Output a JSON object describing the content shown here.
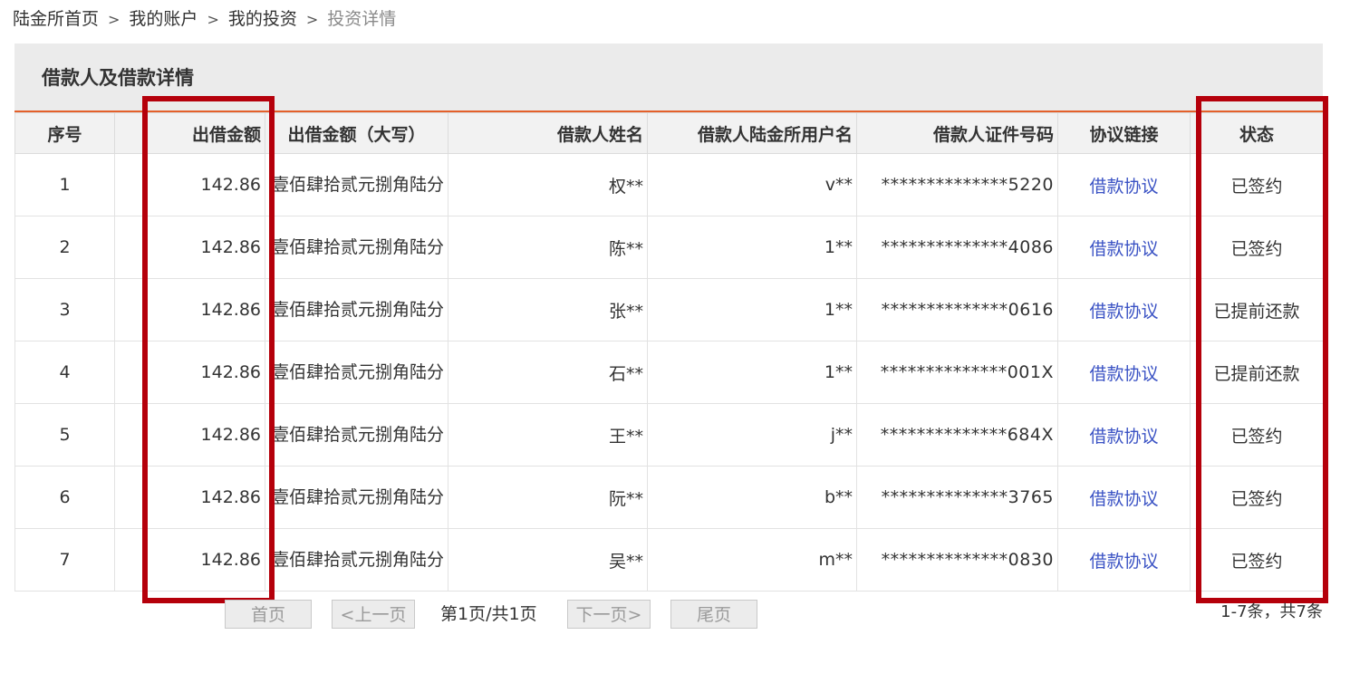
{
  "breadcrumb": {
    "items": [
      "陆金所首页",
      "我的账户",
      "我的投资"
    ],
    "current": "投资详情",
    "separator": ">"
  },
  "panel": {
    "title": "借款人及借款详情"
  },
  "table": {
    "headers": [
      "序号",
      "出借金额",
      "出借金额（大写）",
      "借款人姓名",
      "借款人陆金所用户名",
      "借款人证件号码",
      "协议链接",
      "状态"
    ],
    "rows": [
      {
        "no": "1",
        "amount": "142.86",
        "amount_cn": "壹佰肆拾贰元捌角陆分",
        "name": "权**",
        "user": "v**",
        "id": "**************5220",
        "link": "借款协议",
        "status": "已签约"
      },
      {
        "no": "2",
        "amount": "142.86",
        "amount_cn": "壹佰肆拾贰元捌角陆分",
        "name": "陈**",
        "user": "1**",
        "id": "**************4086",
        "link": "借款协议",
        "status": "已签约"
      },
      {
        "no": "3",
        "amount": "142.86",
        "amount_cn": "壹佰肆拾贰元捌角陆分",
        "name": "张**",
        "user": "1**",
        "id": "**************0616",
        "link": "借款协议",
        "status": "已提前还款"
      },
      {
        "no": "4",
        "amount": "142.86",
        "amount_cn": "壹佰肆拾贰元捌角陆分",
        "name": "石**",
        "user": "1**",
        "id": "**************001X",
        "link": "借款协议",
        "status": "已提前还款"
      },
      {
        "no": "5",
        "amount": "142.86",
        "amount_cn": "壹佰肆拾贰元捌角陆分",
        "name": "王**",
        "user": "j**",
        "id": "**************684X",
        "link": "借款协议",
        "status": "已签约"
      },
      {
        "no": "6",
        "amount": "142.86",
        "amount_cn": "壹佰肆拾贰元捌角陆分",
        "name": "阮**",
        "user": "b**",
        "id": "**************3765",
        "link": "借款协议",
        "status": "已签约"
      },
      {
        "no": "7",
        "amount": "142.86",
        "amount_cn": "壹佰肆拾贰元捌角陆分",
        "name": "吴**",
        "user": "m**",
        "id": "**************0830",
        "link": "借款协议",
        "status": "已签约"
      }
    ]
  },
  "pager": {
    "first": "首页",
    "prev": "<上一页",
    "info": "第1页/共1页",
    "next": "下一页>",
    "last": "尾页",
    "total": "1-7条，共7条"
  },
  "colors": {
    "accent": "#e4602a",
    "highlight": "#b5000b",
    "link": "#3a52c4"
  }
}
